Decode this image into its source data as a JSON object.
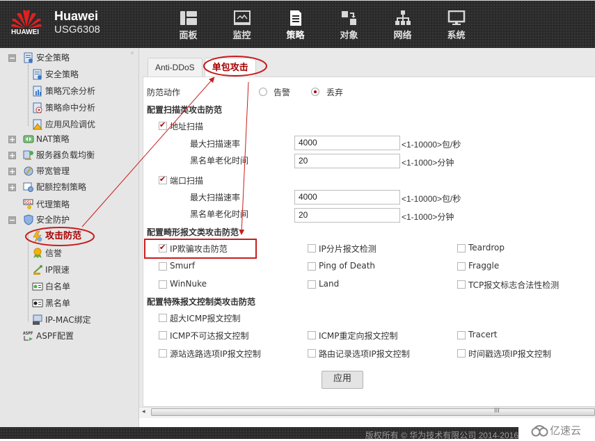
{
  "header": {
    "logo_text": "HUAWEI",
    "brand_name": "Huawei",
    "model": "USG6308",
    "nav": [
      {
        "label": "面板",
        "icon": "dashboard-icon",
        "active": false
      },
      {
        "label": "监控",
        "icon": "monitor-icon",
        "active": false
      },
      {
        "label": "策略",
        "icon": "policy-document-icon",
        "active": true
      },
      {
        "label": "对象",
        "icon": "object-icon",
        "active": false
      },
      {
        "label": "网络",
        "icon": "network-icon",
        "active": false
      },
      {
        "label": "系统",
        "icon": "system-icon",
        "active": false
      }
    ]
  },
  "sidebar": {
    "collapse_glyph": "«",
    "items": [
      {
        "label": "安全策略",
        "level": 0,
        "expander": "−"
      },
      {
        "label": "安全策略",
        "level": 1
      },
      {
        "label": "策略冗余分析",
        "level": 1
      },
      {
        "label": "策略命中分析",
        "level": 1
      },
      {
        "label": "应用风险调优",
        "level": 1
      },
      {
        "label": "NAT策略",
        "level": 0,
        "expander": "+"
      },
      {
        "label": "服务器负载均衡",
        "level": 0,
        "expander": "+"
      },
      {
        "label": "带宽管理",
        "level": 0,
        "expander": "+"
      },
      {
        "label": "配额控制策略",
        "level": 0,
        "expander": "+"
      },
      {
        "label": "代理策略",
        "level": 0
      },
      {
        "label": "安全防护",
        "level": 0,
        "expander": "−"
      },
      {
        "label": "攻击防范",
        "level": 1,
        "selected": true
      },
      {
        "label": "信誉",
        "level": 1
      },
      {
        "label": "IP限速",
        "level": 1
      },
      {
        "label": "白名单",
        "level": 1
      },
      {
        "label": "黑名单",
        "level": 1
      },
      {
        "label": "IP-MAC绑定",
        "level": 1
      },
      {
        "label": "ASPF配置",
        "level": 0
      }
    ]
  },
  "tabs": [
    {
      "label": "Anti-DDoS",
      "active": false
    },
    {
      "label": "单包攻击",
      "active": true
    }
  ],
  "form": {
    "action_label": "防范动作",
    "action_options": [
      {
        "label": "告警",
        "selected": false
      },
      {
        "label": "丢弃",
        "selected": true
      }
    ],
    "scan_section": "配置扫描类攻击防范",
    "address_scan": {
      "label": "地址扫描",
      "checked": true,
      "max_rate_label": "最大扫描速率",
      "max_rate_value": "4000",
      "max_rate_range": "<1-10000>包/秒",
      "aging_label": "黑名单老化时间",
      "aging_value": "20",
      "aging_range": "<1-1000>分钟"
    },
    "port_scan": {
      "label": "端口扫描",
      "checked": true,
      "max_rate_label": "最大扫描速率",
      "max_rate_value": "4000",
      "max_rate_range": "<1-10000>包/秒",
      "aging_label": "黑名单老化时间",
      "aging_value": "20",
      "aging_range": "<1-1000>分钟"
    },
    "malformed_section": "配置畸形报文类攻击防范",
    "malformed": [
      {
        "label": "IP欺骗攻击防范",
        "checked": true
      },
      {
        "label": "IP分片报文检测",
        "checked": false
      },
      {
        "label": "Teardrop",
        "checked": false
      },
      {
        "label": "Smurf",
        "checked": false
      },
      {
        "label": "Ping of Death",
        "checked": false
      },
      {
        "label": "Fraggle",
        "checked": false
      },
      {
        "label": "WinNuke",
        "checked": false
      },
      {
        "label": "Land",
        "checked": false
      },
      {
        "label": "TCP报文标志合法性检测",
        "checked": false
      }
    ],
    "special_section": "配置特殊报文控制类攻击防范",
    "special": [
      {
        "label": "超大ICMP报文控制",
        "checked": false
      },
      {
        "label": "ICMP不可达报文控制",
        "checked": false
      },
      {
        "label": "ICMP重定向报文控制",
        "checked": false
      },
      {
        "label": "Tracert",
        "checked": false
      },
      {
        "label": "源站选路选项IP报文控制",
        "checked": false
      },
      {
        "label": "路由记录选项IP报文控制",
        "checked": false
      },
      {
        "label": "时间戳选项IP报文控制",
        "checked": false
      }
    ],
    "apply_label": "应用"
  },
  "scrollbar": {
    "left_arrow": "◂",
    "grip": "III"
  },
  "footer": {
    "copyright": "版权所有 © 华为技术有限公司 2014-2016"
  },
  "watermark": {
    "text": "亿速云"
  },
  "colors": {
    "accent": "#a60000",
    "annotation": "#c81d1d",
    "header_bg": "#2a2a2a",
    "sidebar_bg": "#e6e6e6"
  }
}
